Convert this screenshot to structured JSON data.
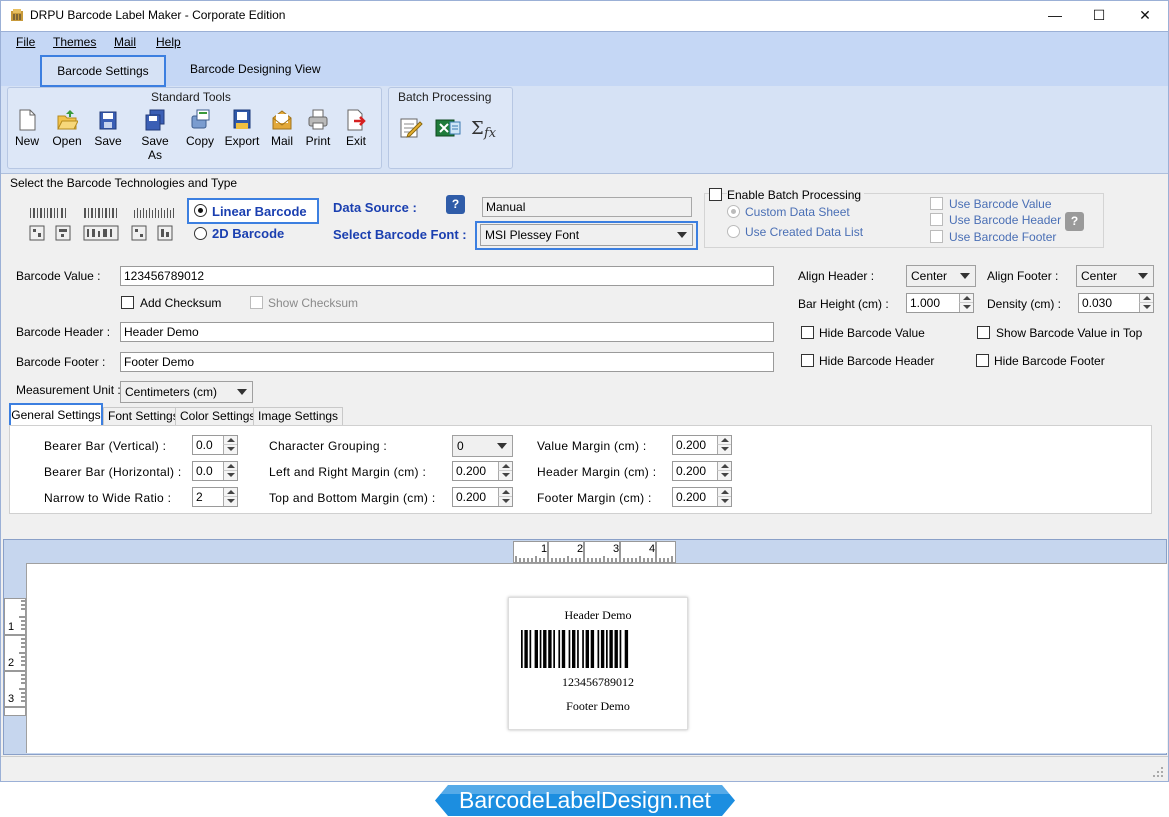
{
  "window": {
    "title": "DRPU Barcode Label Maker - Corporate Edition",
    "minimize": "—",
    "maximize": "☐",
    "close": "✕"
  },
  "menu": [
    "File",
    "Themes",
    "Mail",
    "Help"
  ],
  "ribbon": {
    "tabs": [
      "Barcode Settings",
      "Barcode Designing View"
    ],
    "standard_tools_label": "Standard Tools",
    "tools": [
      {
        "label": "New",
        "icon": "new-document-icon"
      },
      {
        "label": "Open",
        "icon": "open-folder-icon"
      },
      {
        "label": "Save",
        "icon": "save-icon"
      },
      {
        "label": "Save As",
        "icon": "save-as-icon"
      },
      {
        "label": "Copy",
        "icon": "copy-icon"
      },
      {
        "label": "Export",
        "icon": "export-icon"
      },
      {
        "label": "Mail",
        "icon": "mail-icon"
      },
      {
        "label": "Print",
        "icon": "print-icon"
      },
      {
        "label": "Exit",
        "icon": "exit-icon"
      }
    ],
    "batch_label": "Batch Processing",
    "batch_tools": [
      {
        "icon": "batch-edit-icon"
      },
      {
        "icon": "batch-excel-icon"
      },
      {
        "icon": "sigma-fx-icon"
      }
    ]
  },
  "technologies": {
    "section_label": "Select the Barcode Technologies and Type",
    "linear_label": "Linear Barcode",
    "linear_selected": true,
    "twod_label": "2D Barcode",
    "data_source_label": "Data Source :",
    "data_source_value": "Manual",
    "font_label": "Select Barcode Font :",
    "font_value": "MSI Plessey Font"
  },
  "batch": {
    "enable_label": "Enable Batch Processing",
    "custom_sheet": "Custom Data Sheet",
    "created_list": "Use Created Data List",
    "use_value": "Use Barcode Value",
    "use_header": "Use Barcode Header",
    "use_footer": "Use Barcode Footer"
  },
  "fields": {
    "barcode_value_label": "Barcode Value :",
    "barcode_value": "123456789012",
    "add_checksum": "Add Checksum",
    "show_checksum": "Show Checksum",
    "header_label": "Barcode Header :",
    "header_value": "Header Demo",
    "footer_label": "Barcode Footer :",
    "footer_value": "Footer Demo",
    "unit_label": "Measurement Unit :",
    "unit_value": "Centimeters (cm)"
  },
  "align": {
    "align_header_label": "Align Header :",
    "align_header_value": "Center",
    "align_footer_label": "Align Footer :",
    "align_footer_value": "Center",
    "bar_height_label": "Bar Height (cm) :",
    "bar_height_value": "1.000",
    "density_label": "Density (cm) :",
    "density_value": "0.030",
    "hide_value": "Hide Barcode Value",
    "show_value_top": "Show Barcode Value in Top",
    "hide_header": "Hide Barcode Header",
    "hide_footer": "Hide Barcode Footer"
  },
  "subtabs": [
    "General Settings",
    "Font Settings",
    "Color Settings",
    "Image Settings"
  ],
  "general": {
    "bearer_v_label": "Bearer Bar (Vertical) :",
    "bearer_v": "0.0",
    "bearer_h_label": "Bearer Bar (Horizontal) :",
    "bearer_h": "0.0",
    "ratio_label": "Narrow to Wide Ratio :",
    "ratio": "2",
    "char_group_label": "Character Grouping :",
    "char_group": "0",
    "lr_margin_label": "Left and Right Margin (cm) :",
    "lr_margin": "0.200",
    "tb_margin_label": "Top and Bottom Margin (cm) :",
    "tb_margin": "0.200",
    "value_margin_label": "Value Margin (cm) :",
    "value_margin": "0.200",
    "header_margin_label": "Header Margin (cm) :",
    "header_margin": "0.200",
    "footer_margin_label": "Footer Margin (cm) :",
    "footer_margin": "0.200"
  },
  "preview": {
    "h_ruler": [
      "1",
      "2",
      "3",
      "4"
    ],
    "v_ruler": [
      "1",
      "2",
      "3"
    ],
    "header": "Header Demo",
    "value": "123456789012",
    "footer": "Footer Demo"
  },
  "brand": {
    "text": "BarcodeLabelDesign.net",
    "color": "#1c8ee0"
  }
}
